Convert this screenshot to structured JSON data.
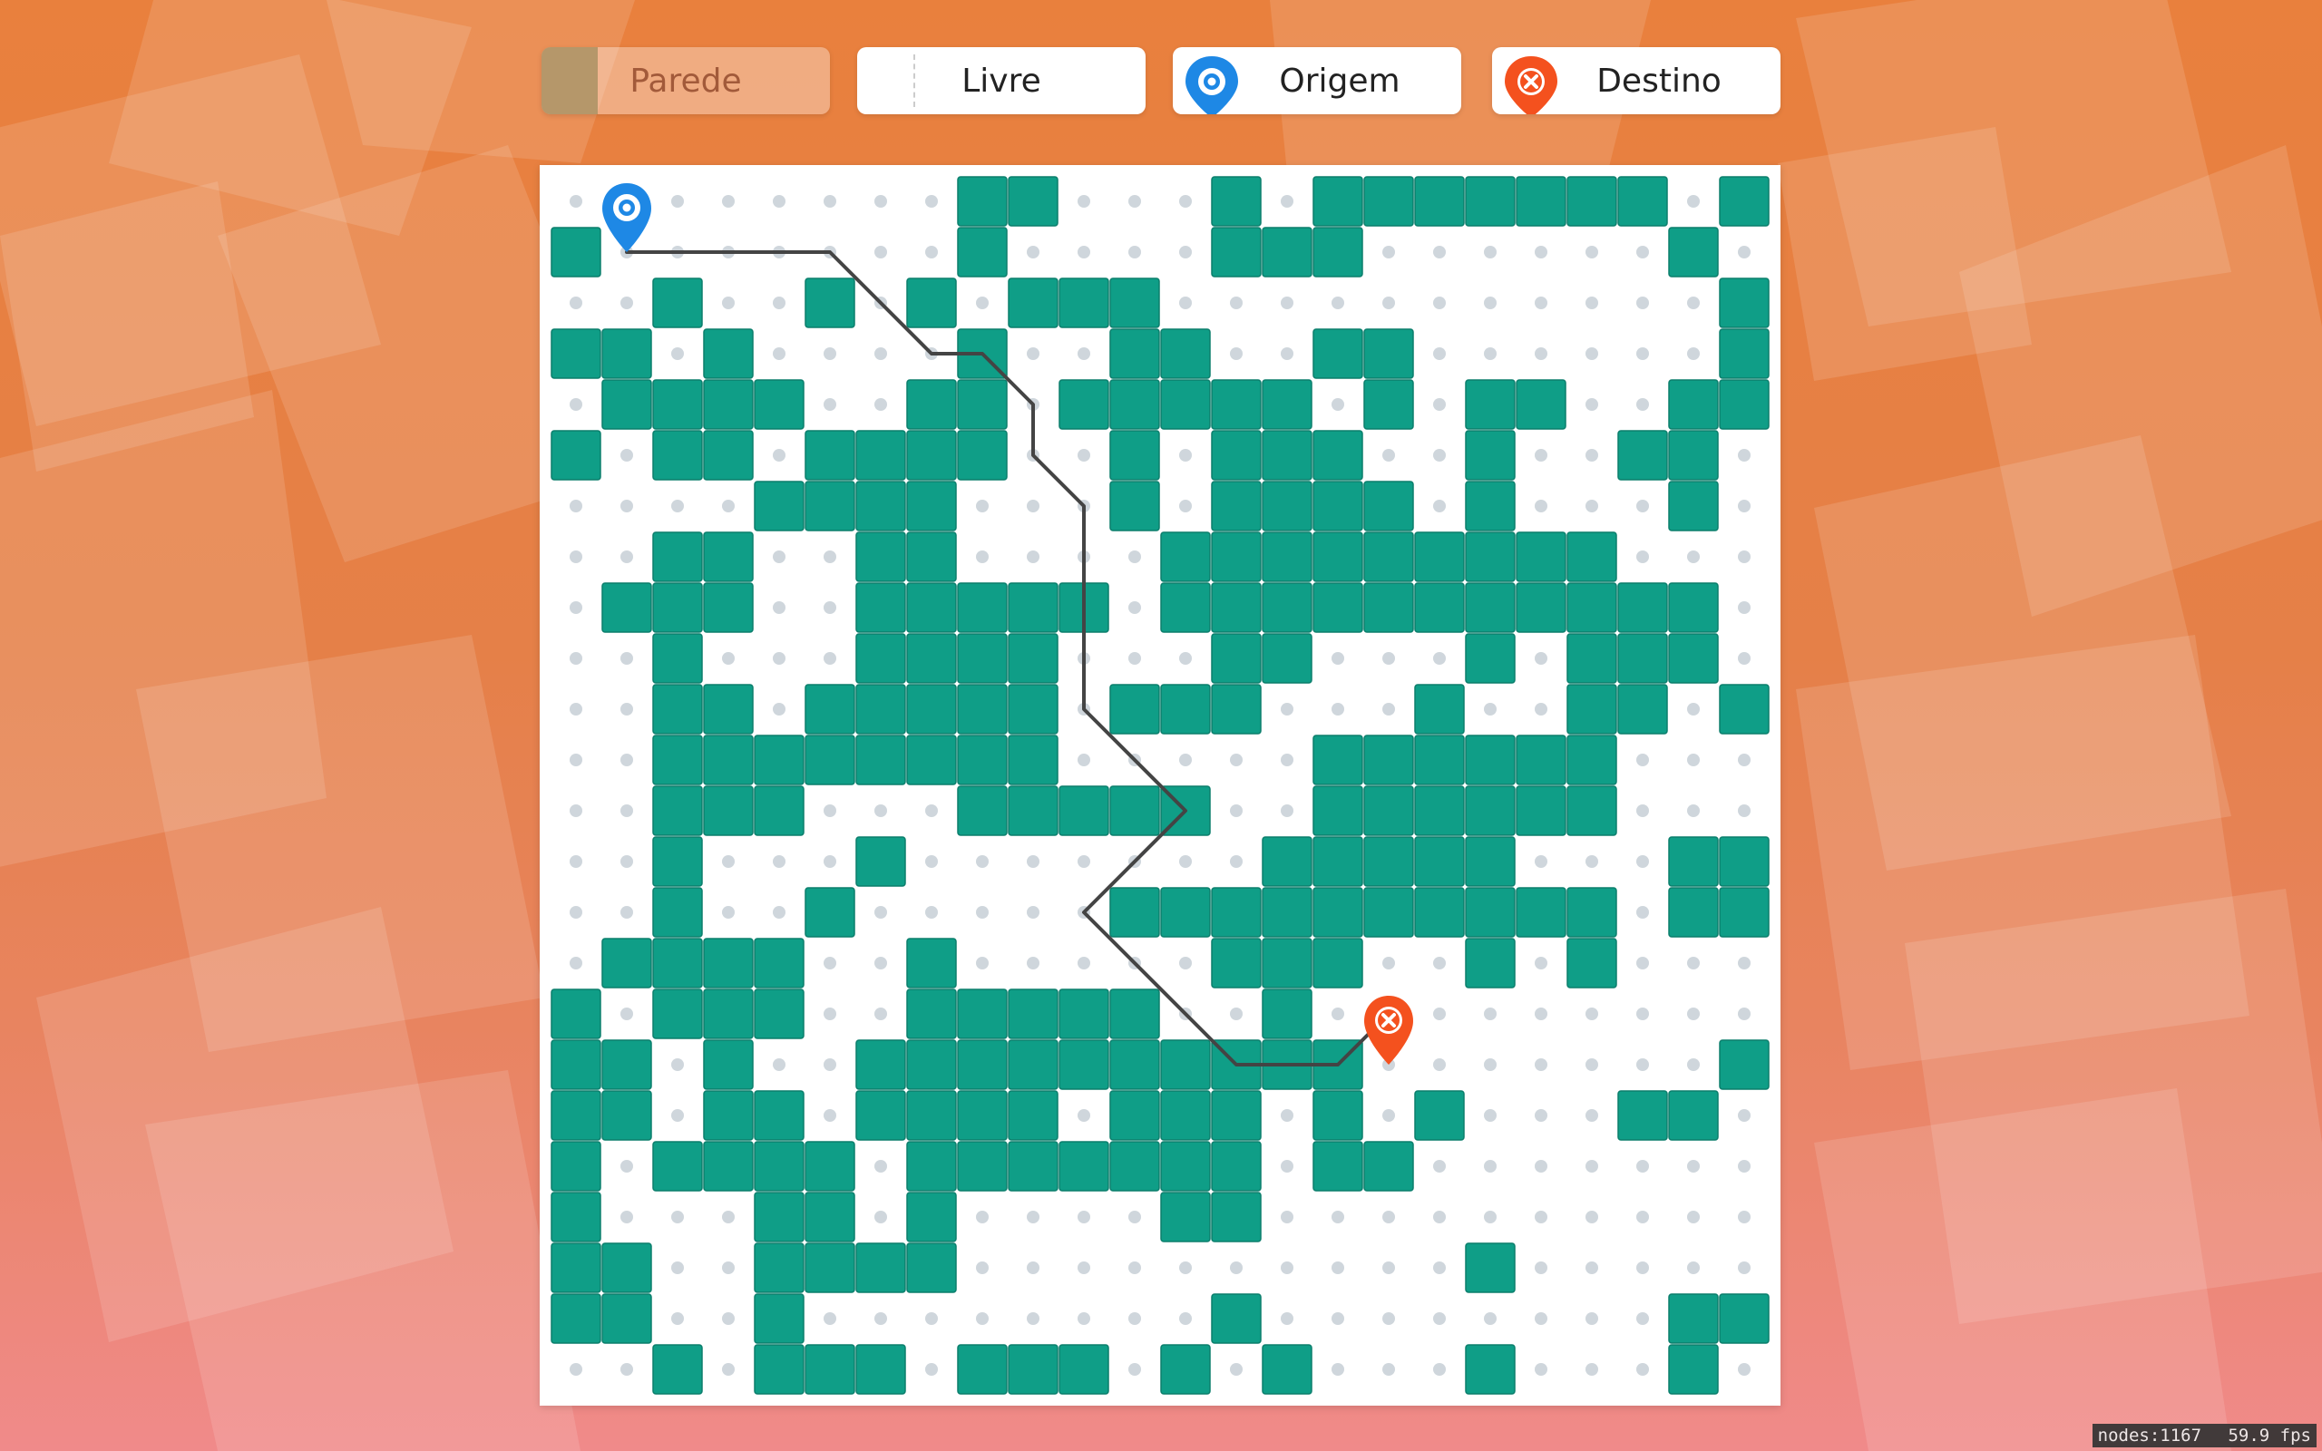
{
  "toolbar": {
    "wall_label": "Parede",
    "free_label": "Livre",
    "origin_label": "Origem",
    "dest_label": "Destino"
  },
  "colors": {
    "wall": "#0f9e87",
    "wall_border": "#0b7e6c",
    "dot": "#cfd6dc",
    "path": "#444444",
    "origin": "#1e88e5",
    "destination": "#f4511e"
  },
  "grid": {
    "cols": 24,
    "rows": 24,
    "walls": [
      "...##...#.#######..#.",
      "...............#.......",
      "........................",
      "........................"
    ],
    "rows_data": [
      "........##...#.#######.#.",
      "#.......#....###......#..",
      "..#..#.#.###...........#.",
      "##.#....#..##..##......#.",
      ".####..##.#####.#.##..##.",
      "#.##.####..#.###..#..##..",
      "....####...#.####.#...#..",
      "..##..##....#########....",
      ".###..#####.###########..",
      "..#...####...##...#.###..",
      "..##.#####.###...#..##.#.",
      "..########.....######....",
      "..###...#####..######....",
      "..#...#.......#####...##.",
      "..#..#.....##########.##.",
      ".####..#.....###..#.#....",
      "#.###..#####..#.........#",
      "##.#..##########.......#.",
      "##.##.####.###.#.#...##..",
      "#.####.#######.##.......",
      "#...##.#....##.........",
      "##..####..........#.....##",
      "##..#........#........##",
      "..#.###.###.#.#...#...#.."
    ],
    "origin": {
      "col": 1,
      "row": 1
    },
    "destination": {
      "col": 16,
      "row": 17
    },
    "path": [
      [
        1,
        1
      ],
      [
        5,
        1
      ],
      [
        7,
        3
      ],
      [
        8,
        3
      ],
      [
        9,
        4
      ],
      [
        9,
        5
      ],
      [
        10,
        6
      ],
      [
        10,
        10
      ],
      [
        12,
        12
      ],
      [
        10,
        14
      ],
      [
        13,
        17
      ],
      [
        15,
        17
      ],
      [
        16,
        16
      ]
    ]
  },
  "status": {
    "nodes": "nodes:1167",
    "fps": "59.9 fps"
  }
}
